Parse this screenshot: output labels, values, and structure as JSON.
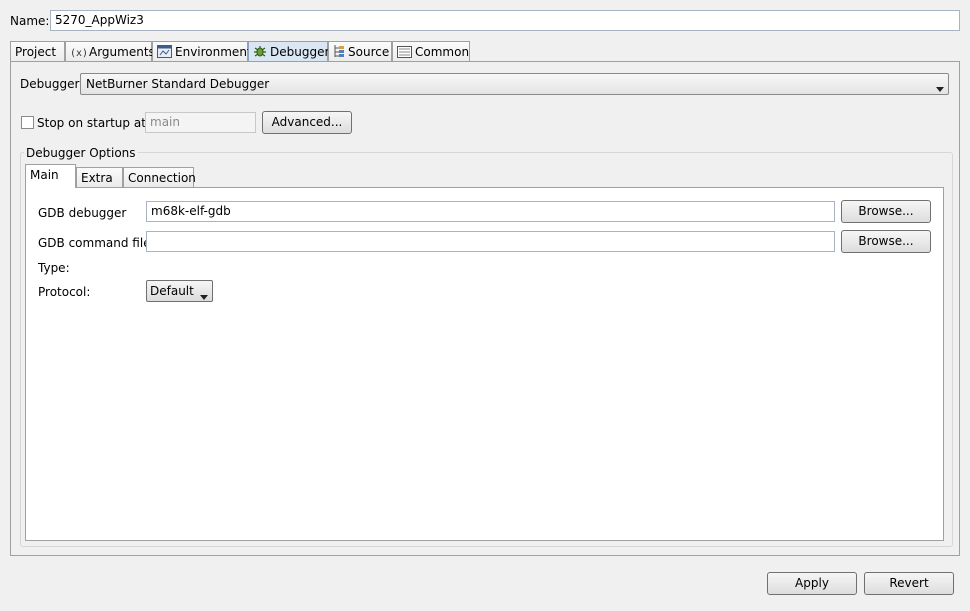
{
  "name": {
    "label": "Name:",
    "value": "5270_AppWiz3"
  },
  "tabs": [
    {
      "label": "Project",
      "icon": "none"
    },
    {
      "label": "Arguments",
      "icon": "arguments-icon"
    },
    {
      "label": "Environment",
      "icon": "environment-icon"
    },
    {
      "label": "Debugger",
      "icon": "debugger-bug-icon"
    },
    {
      "label": "Source",
      "icon": "source-icon"
    },
    {
      "label": "Common",
      "icon": "common-icon"
    }
  ],
  "debugger": {
    "label": "Debugger:",
    "selected": "NetBurner Standard Debugger"
  },
  "startup": {
    "label": "Stop on startup at:",
    "value": "main",
    "checked": false,
    "advanced_label": "Advanced..."
  },
  "options": {
    "group_label": "Debugger Options",
    "tabs": [
      "Main",
      "Extra",
      "Connection"
    ],
    "gdb_debugger_label": "GDB debugger",
    "gdb_debugger_value": "m68k-elf-gdb",
    "gdb_command_label": "GDB command file:",
    "gdb_command_value": "",
    "browse_label": "Browse...",
    "type_label": "Type:",
    "protocol_label": "Protocol:",
    "protocol_value": "Default"
  },
  "footer": {
    "apply_label": "Apply",
    "revert_label": "Revert"
  }
}
